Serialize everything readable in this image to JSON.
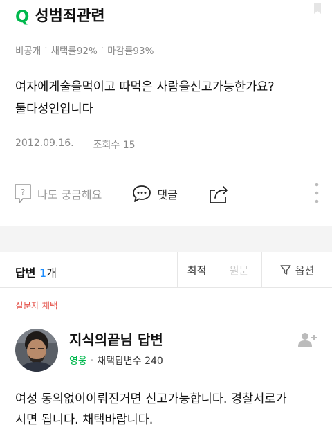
{
  "question": {
    "q_mark": "Q",
    "title": "성범죄관련",
    "meta": {
      "visibility": "비공개",
      "adoption_rate": "채택률92%",
      "closing_rate": "마감률93%"
    },
    "body_line1": "여자에게술을먹이고 따먹은 사람을신고가능한가요?",
    "body_line2": "둘다성인입니다",
    "date": "2012.09.16.",
    "views_label": "조회수 15"
  },
  "actions": {
    "curious_label": "나도 궁금해요",
    "comment_label": "댓글"
  },
  "answers_bar": {
    "prefix": "답변 ",
    "count": "1",
    "unit": "개",
    "sort_latest": "최적",
    "sort_original": "원문",
    "options_label": "옵션"
  },
  "answer": {
    "chosen_label": "질문자 채택",
    "author_title": "지식의끝님 답변",
    "grade": "영웅",
    "adopted_count": "채택답변수 240",
    "body_line1": "여성 동의없이이뤄진거면 신고가능합니다. 경찰서로가",
    "body_line2": "시면 됩니다. 채택바랍니다."
  },
  "colors": {
    "brand_green": "#00b84d",
    "accent_blue": "#1a8cff",
    "chosen_red": "#e4524a"
  }
}
